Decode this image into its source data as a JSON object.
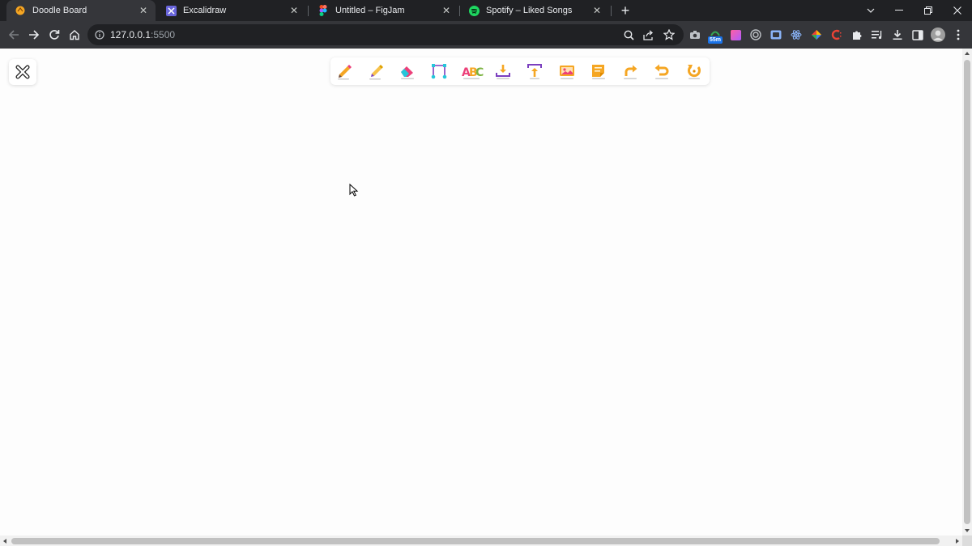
{
  "browser": {
    "tabs": [
      {
        "title": "Doodle Board",
        "icon": "doodle-board-favicon",
        "active": true
      },
      {
        "title": "Excalidraw",
        "icon": "excalidraw-favicon",
        "active": false
      },
      {
        "title": "Untitled – FigJam",
        "icon": "figma-favicon",
        "active": false
      },
      {
        "title": "Spotify – Liked Songs",
        "icon": "spotify-favicon",
        "active": false
      }
    ],
    "address": {
      "host": "127.0.0.1",
      "port": ":5500"
    },
    "extension_badge": "55m"
  },
  "toolbar_tools": [
    {
      "name": "pencil-tool",
      "icon": "pencil-icon"
    },
    {
      "name": "highlighter-tool",
      "icon": "highlighter-icon"
    },
    {
      "name": "eraser-tool",
      "icon": "eraser-icon"
    },
    {
      "name": "shapes-tool",
      "icon": "bezier-shape-icon"
    },
    {
      "name": "text-tool",
      "icon": "abc-text-icon"
    },
    {
      "name": "download-tool",
      "icon": "download-icon"
    },
    {
      "name": "upload-tool",
      "icon": "upload-icon"
    },
    {
      "name": "image-tool",
      "icon": "image-icon"
    },
    {
      "name": "sticky-note-tool",
      "icon": "sticky-note-icon"
    },
    {
      "name": "redo-tool",
      "icon": "redo-icon"
    },
    {
      "name": "undo-tool",
      "icon": "undo-icon"
    },
    {
      "name": "reset-tool",
      "icon": "reset-icon"
    }
  ],
  "colors": {
    "chrome_dark": "#202124",
    "chrome_toolbar": "#35363a",
    "tool_orange": "#f5a623",
    "tool_purple": "#7b3fbf",
    "tool_pink": "#ec407a",
    "tool_cyan": "#26c6da"
  }
}
